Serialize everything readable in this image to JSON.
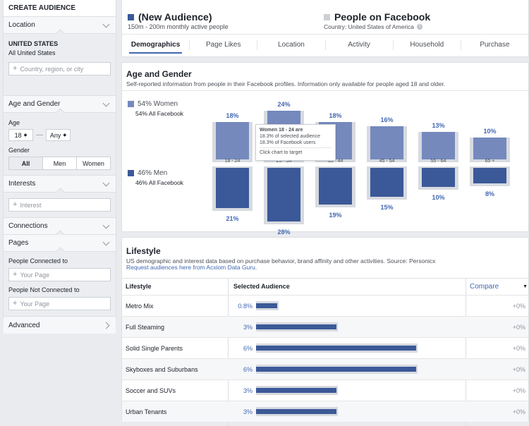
{
  "sidebar": {
    "title": "CREATE AUDIENCE",
    "location": {
      "label": "Location",
      "country": "UNITED STATES",
      "scope": "All United States",
      "placeholder": "Country, region, or city"
    },
    "age_gender": {
      "label": "Age and Gender",
      "age_label": "Age",
      "age_min": "18",
      "age_max": "Any",
      "gender_label": "Gender",
      "gender_options": [
        "All",
        "Men",
        "Women"
      ],
      "gender_selected": "All"
    },
    "interests": {
      "label": "Interests",
      "placeholder": "Interest"
    },
    "connections": {
      "label": "Connections"
    },
    "pages": {
      "label": "Pages",
      "connected_label": "People Connected to",
      "not_connected_label": "People Not Connected to",
      "placeholder": "Your Page"
    },
    "advanced": {
      "label": "Advanced"
    }
  },
  "header": {
    "audience_name": "(New Audience)",
    "audience_size": "150m - 200m monthly active people",
    "compare_name": "People on Facebook",
    "compare_sub": "Country: United States of America",
    "tabs": [
      "Demographics",
      "Page Likes",
      "Location",
      "Activity",
      "Household",
      "Purchase"
    ],
    "active_tab": "Demographics"
  },
  "age_gender": {
    "title": "Age and Gender",
    "subtitle": "Self-reported information from people in their Facebook profiles. Information only available for people aged 18 and older.",
    "women_label": "54% Women",
    "women_sub": "54% All Facebook",
    "men_label": "46% Men",
    "men_sub": "46% All Facebook",
    "tooltip": {
      "line1": "Women 18 - 24 are",
      "line2": "18.3% of selected audience",
      "line3": "18.3% of Facebook users",
      "line4": "Click chart to target"
    }
  },
  "chart_data": {
    "type": "bar",
    "categories": [
      "18 - 24",
      "25 - 34",
      "35 - 44",
      "45 - 54",
      "55 - 64",
      "65 +"
    ],
    "series": [
      {
        "name": "Women",
        "values": [
          18,
          24,
          18,
          16,
          13,
          10
        ],
        "labels": [
          "18%",
          "24%",
          "18%",
          "16%",
          "13%",
          "10%"
        ]
      },
      {
        "name": "Men",
        "values": [
          21,
          28,
          19,
          15,
          10,
          8
        ],
        "labels": [
          "21%",
          "28%",
          "19%",
          "15%",
          "10%",
          "8%"
        ]
      }
    ],
    "colors": {
      "women": "#7589bd",
      "men": "#3b5998",
      "baseline": "#d7dae0"
    }
  },
  "lifestyle": {
    "title": "Lifestyle",
    "subtitle": "US demographic and interest data based on purchase behavior, brand affinity and other activities. Source: Personicx",
    "link": "Request audiences here from Acxiom Data Guru.",
    "col_lifestyle": "Lifestyle",
    "col_selected": "Selected Audience",
    "col_compare": "Compare",
    "rows": [
      {
        "name": "Metro Mix",
        "value": "0.8%",
        "pct": 0.8,
        "compare": "+0%"
      },
      {
        "name": "Full Steaming",
        "value": "3%",
        "pct": 3,
        "compare": "+0%"
      },
      {
        "name": "Solid Single Parents",
        "value": "6%",
        "pct": 6,
        "compare": "+0%"
      },
      {
        "name": "Skyboxes and Suburbans",
        "value": "6%",
        "pct": 6,
        "compare": "+0%"
      },
      {
        "name": "Soccer and SUVs",
        "value": "3%",
        "pct": 3,
        "compare": "+0%"
      },
      {
        "name": "Urban Tenants",
        "value": "3%",
        "pct": 3,
        "compare": "+0%"
      }
    ]
  }
}
